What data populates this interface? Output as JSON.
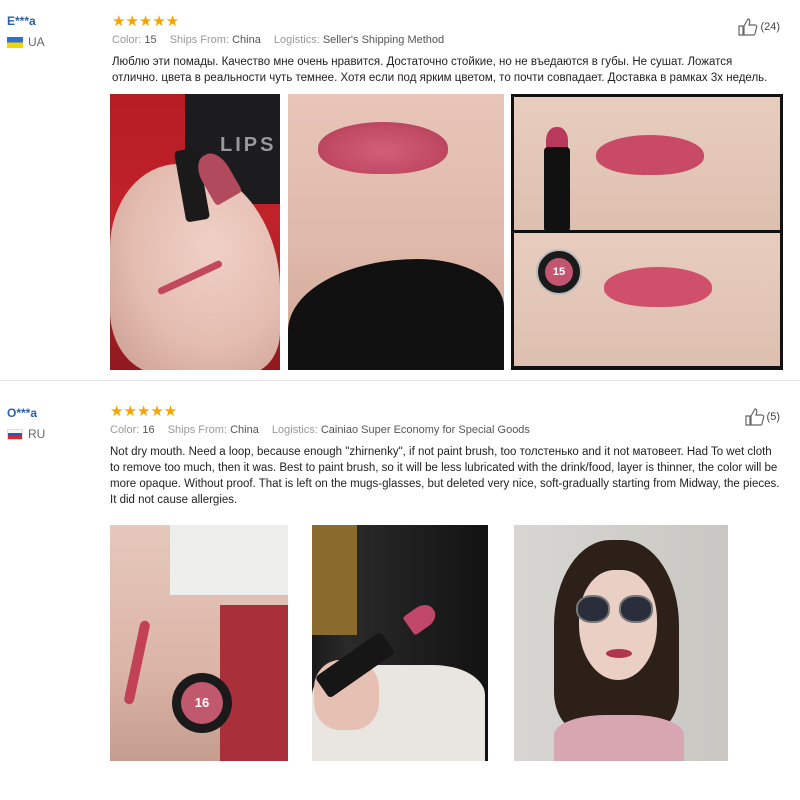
{
  "reviews": [
    {
      "user": "E***a",
      "country": "UA",
      "rating": "★★★★★",
      "meta": {
        "color_key": "Color:",
        "color_val": "15",
        "ships_key": "Ships From:",
        "ships_val": "China",
        "log_key": "Logistics:",
        "log_val": "Seller's Shipping Method"
      },
      "helpful_count": "(24)",
      "text": "Люблю эти помады. Качество мне очень нравится. Достаточно стойкие, но не въедаются в губы. Не сушат. Ложатся отлично. цвета в реальности чуть темнее. Хотя если под ярким цветом, то почти совпадает. Доставка в рамках 3х недель.",
      "photos": [
        "hand-swatch-photo",
        "lips-photo",
        "lipstick-collage-photo"
      ],
      "box_text": "LIPS",
      "cap_number": "15"
    },
    {
      "user": "O***a",
      "country": "RU",
      "rating": "★★★★★",
      "meta": {
        "color_key": "Color:",
        "color_val": "16",
        "ships_key": "Ships From:",
        "ships_val": "China",
        "log_key": "Logistics:",
        "log_val": "Cainiao Super Economy for Special Goods"
      },
      "helpful_count": "(5)",
      "text": "Not dry mouth. Need a loop, because enough \"zhirnenky\", if not paint brush, too толстенько and it not матовеет. Had To wet cloth to remove too much, then it was. Best to paint brush, so it will be less lubricated with the drink/food, layer is thinner, the color will be more opaque. Without proof. That is left on the mugs-glasses, but deleted very nice, soft-gradually starting from Midway, the pieces. It did not cause allergies.",
      "photos": [
        "arm-swatch-photo",
        "bathroom-lipstick-photo",
        "selfie-photo"
      ],
      "cap_number": "16"
    }
  ],
  "colors": {
    "star": "#f7a400",
    "username": "#2a5fab",
    "meta_key": "#999999"
  },
  "icons": {
    "helpful": "thumbs-up-icon"
  }
}
